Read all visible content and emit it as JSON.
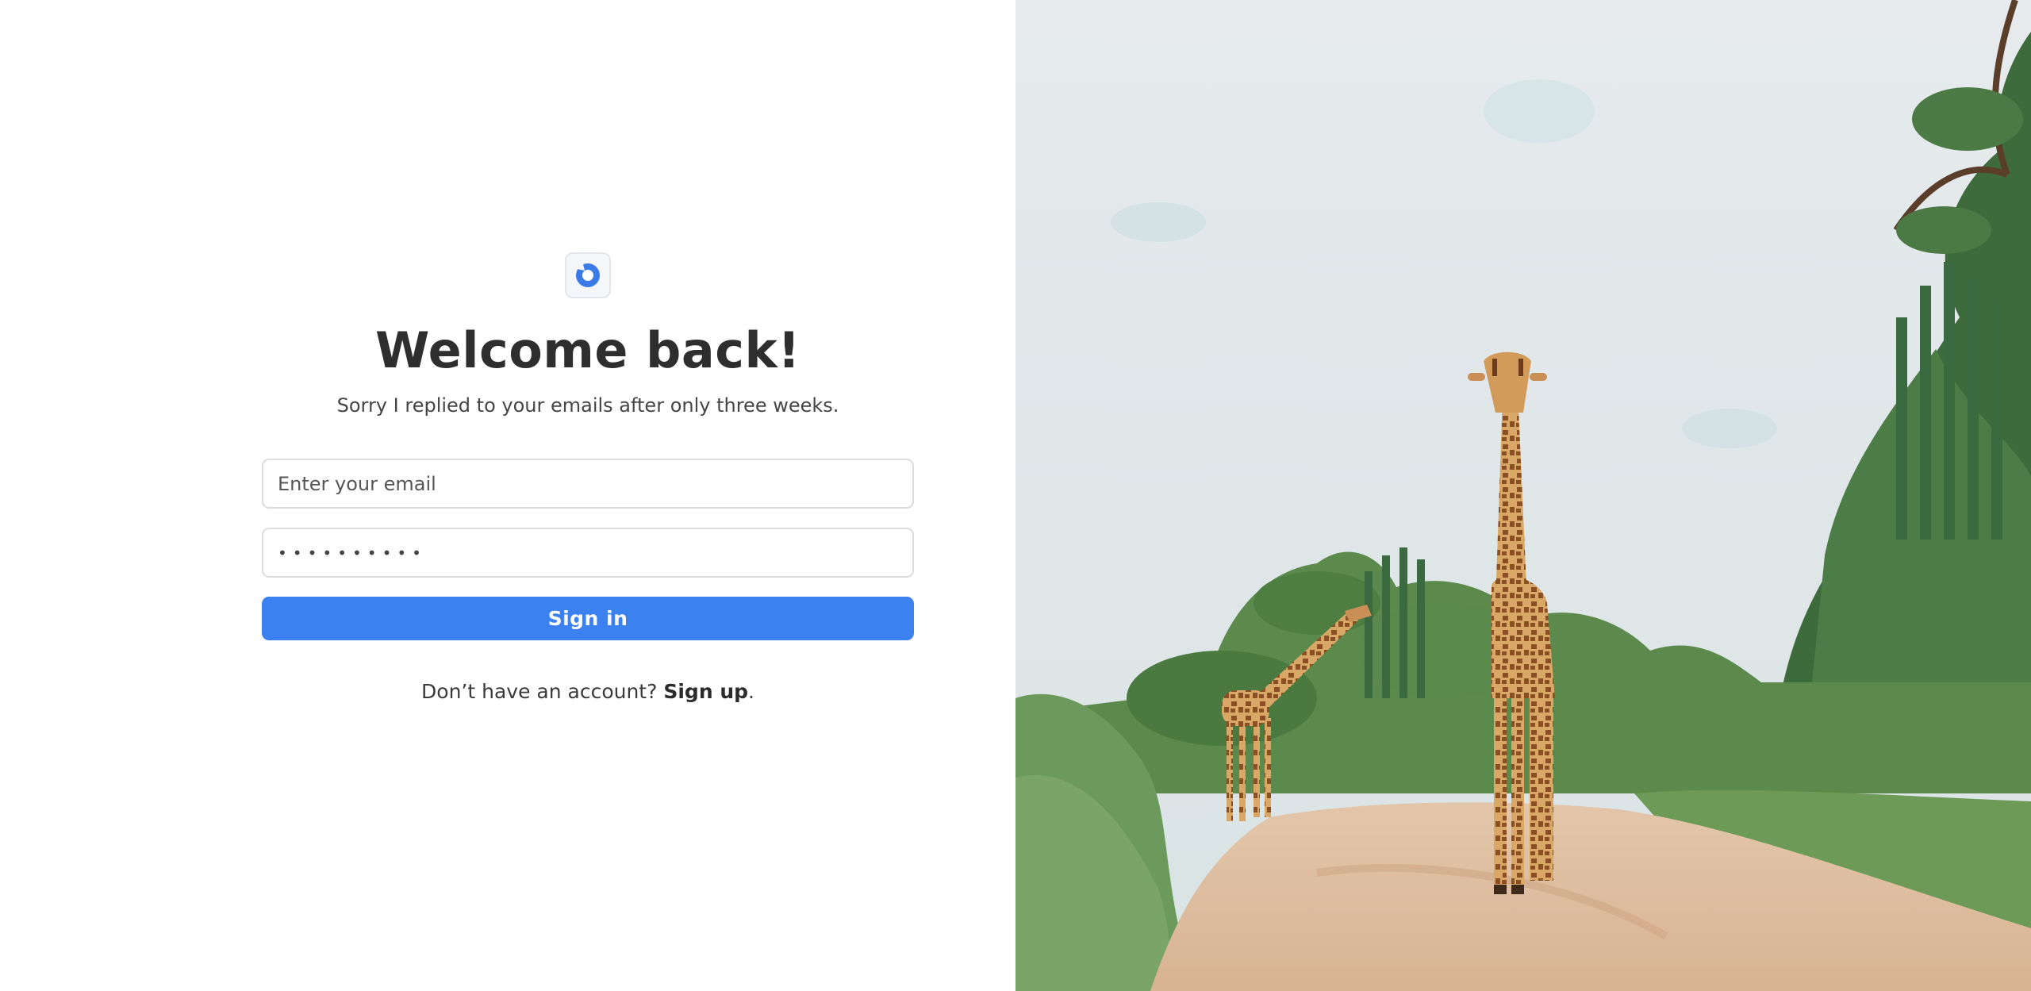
{
  "brand": {
    "logo_icon": "donut-logo-icon",
    "accent_color": "#3b82f0"
  },
  "login": {
    "title": "Welcome back!",
    "subtitle": "Sorry I replied to your emails after only three weeks.",
    "email_placeholder": "Enter your email",
    "email_value": "",
    "password_masked": "••••••••••",
    "signin_label": "Sign in",
    "signup_prompt": "Don’t have an account?",
    "signup_link": "Sign up",
    "signup_suffix": "."
  },
  "hero_image": {
    "subject": "giraffes-on-dirt-road-photo"
  }
}
